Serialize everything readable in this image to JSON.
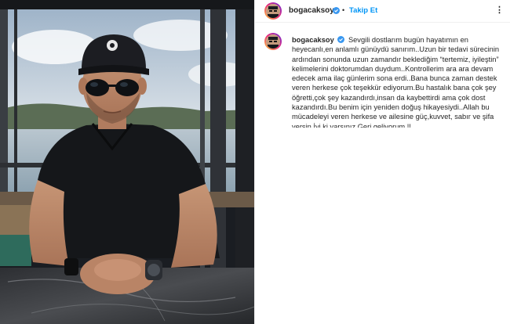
{
  "post": {
    "username": "bogacaksoy",
    "follow_label": "Takip Et",
    "separator": "•",
    "more_label": "⋮",
    "caption_username": "bogacaksoy",
    "caption_text": "Sevgili dostlarım bugün hayatımın en heyecanlı,en anlamlı günüydü sanırım..Uzun bir tedavi sürecinin ardından sonunda uzun zamandır beklediğim “tertemiz, iyileştin” kelimelerini doktorumdan duydum..Kontrollerim ara ara devam edecek ama ilaç günlerim sona erdi..Bana bunca zaman destek veren herkese çok teşekkür ediyorum.Bu hastalık bana çok şey öğretti,çok şey kazandırdı,insan da kaybettirdi ama çok dost kazandırdı.Bu benim için yeniden doğuş hikayesiydi..Allah bu mücadeleyi veren herkese ve ailesine güç,kuvvet, sabır ve şifa versin.İyi ki varsınız.Geri geliyorum !!"
  },
  "colors": {
    "link_blue": "#0095f6",
    "verified_blue": "#3897f0",
    "text": "#262626",
    "border": "#efefef"
  },
  "icons": [
    "verified-badge-icon",
    "more-options-icon"
  ]
}
